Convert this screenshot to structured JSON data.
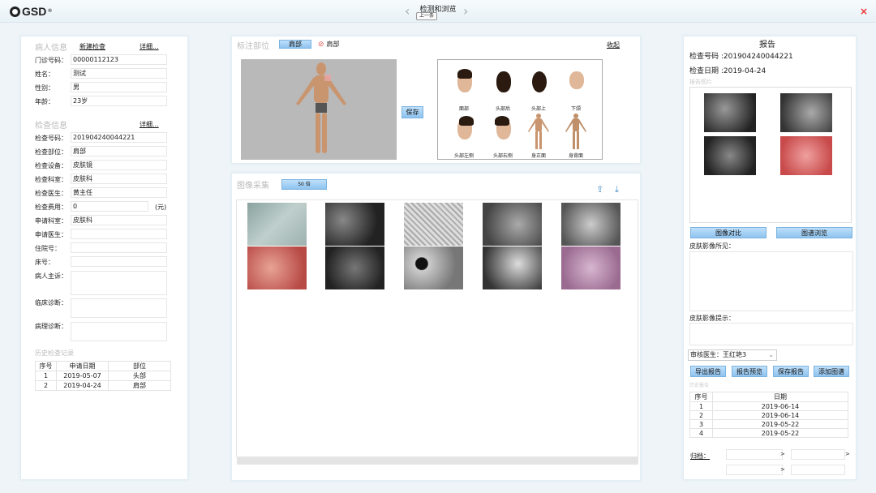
{
  "app": {
    "logo_text": "GSD",
    "title": "检测和浏览",
    "prev_label": "上一条"
  },
  "patient": {
    "section_title": "病人信息",
    "new_exam": "新建检查",
    "detail": "详细...",
    "fields": [
      {
        "label": "门诊号码：",
        "value": "00000112123"
      },
      {
        "label": "姓名：",
        "value": "测试"
      },
      {
        "label": "性别：",
        "value": "男"
      },
      {
        "label": "年龄：",
        "value": "23岁"
      }
    ]
  },
  "exam": {
    "section_title": "检查信息",
    "detail": "详细...",
    "fields": [
      {
        "label": "检查号码：",
        "value": "201904240044221"
      },
      {
        "label": "检查部位：",
        "value": "肩部"
      },
      {
        "label": "检查设备：",
        "value": "皮肤镜"
      },
      {
        "label": "检查科室：",
        "value": "皮肤科"
      },
      {
        "label": "检查医生：",
        "value": "黄主任"
      },
      {
        "label": "检查费用：",
        "value": "0",
        "unit": "(元)"
      },
      {
        "label": "申请科室：",
        "value": "皮肤科"
      },
      {
        "label": "申请医生：",
        "value": ""
      },
      {
        "label": "住院号：",
        "value": ""
      },
      {
        "label": "床号：",
        "value": ""
      }
    ],
    "complaint_label": "病人主诉：",
    "clinical_label": "临床诊断：",
    "pathology_label": "病理诊断："
  },
  "history": {
    "title": "历史检查记录",
    "headers": [
      "序号",
      "申请日期",
      "部位"
    ],
    "rows": [
      [
        "1",
        "2019-05-07",
        "头部"
      ],
      [
        "2",
        "2019-04-24",
        "肩部"
      ]
    ]
  },
  "mark": {
    "title": "标注部位",
    "tag": "肩部",
    "checked_label": "肩部",
    "collapse": "收起",
    "save": "保存",
    "views": [
      "面部",
      "头部后",
      "头部上",
      "下颌",
      "头部左侧",
      "头部右侧",
      "身正面",
      "身背面"
    ]
  },
  "capture": {
    "title": "图像采集",
    "zoom": "50 倍",
    "upload_icon": "upload-icon",
    "download_icon": "download-icon"
  },
  "report": {
    "title": "报告",
    "exam_no": "检查号码 :201904240044221",
    "exam_date": "检查日期 :2019-04-24",
    "images_title": "报告图片",
    "compare_btn": "图像对比",
    "atlas_btn": "图谱浏览",
    "findings_label": "皮肤影像所见：",
    "hint_label": "皮肤影像提示：",
    "reviewer": "审核医生：王红艳3",
    "actions": [
      "导出报告",
      "报告预览",
      "保存报告",
      "添加图谱"
    ],
    "history_title": "历史报告",
    "history_headers": [
      "序号",
      "日期"
    ],
    "history_rows": [
      [
        "1",
        "2019-06-14"
      ],
      [
        "2",
        "2019-06-14"
      ],
      [
        "3",
        "2019-05-22"
      ],
      [
        "4",
        "2019-05-22"
      ]
    ],
    "archive_label": "归档："
  },
  "colors": {
    "accent": "#8fc3ef",
    "close": "#ee3333",
    "panel_bg": "#eef4f8"
  }
}
